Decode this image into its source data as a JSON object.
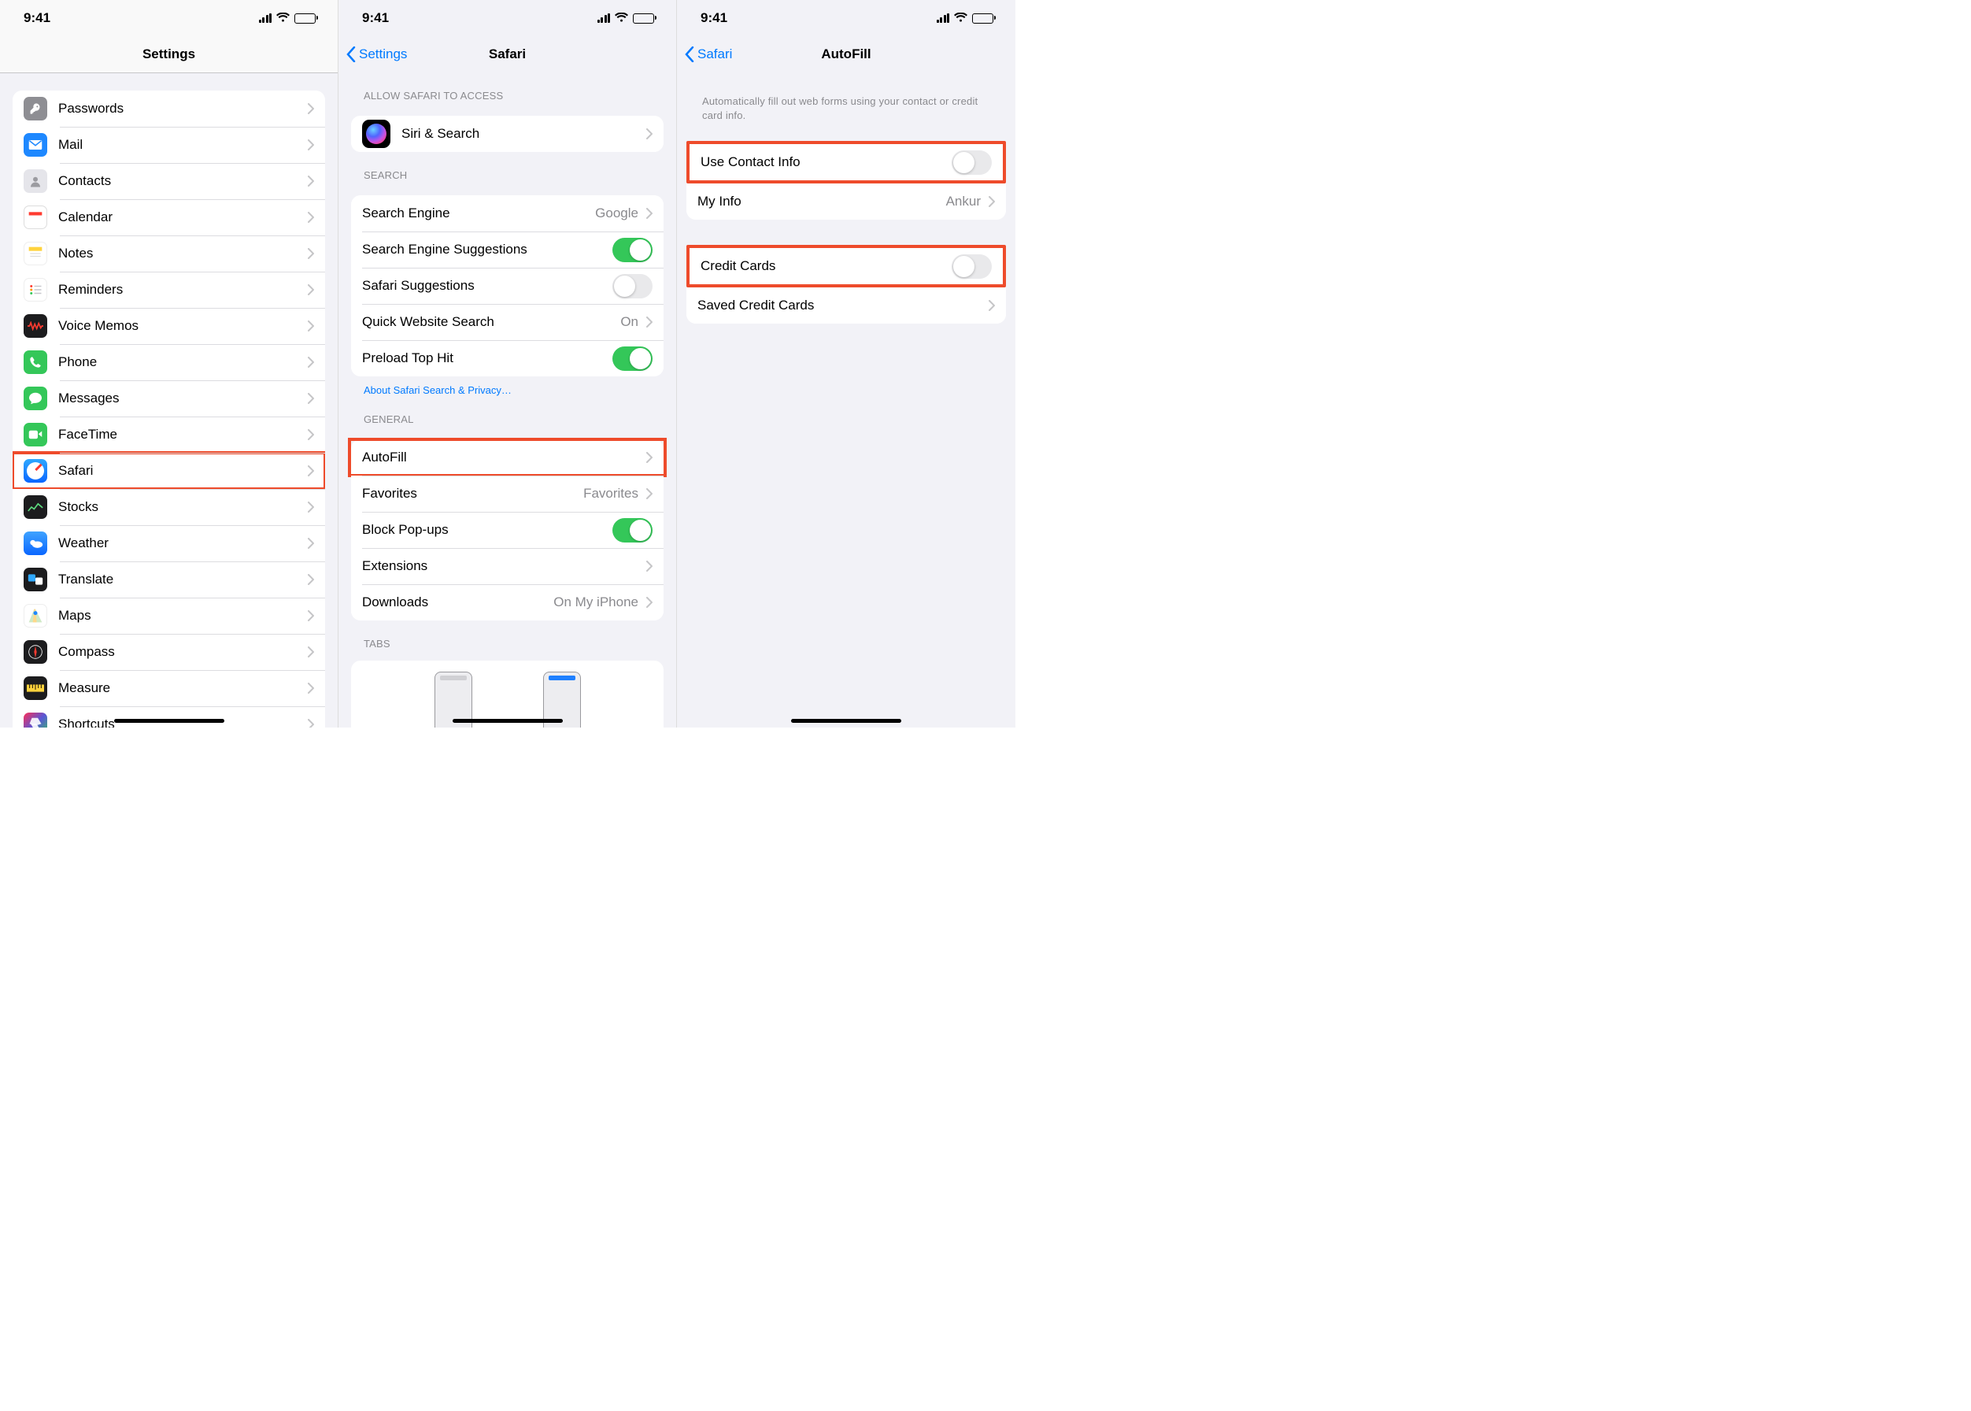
{
  "status": {
    "time": "9:41"
  },
  "p1": {
    "title": "Settings",
    "items": [
      {
        "label": "Passwords",
        "icon_name": "key-icon"
      },
      {
        "label": "Mail",
        "icon_name": "mail-icon"
      },
      {
        "label": "Contacts",
        "icon_name": "contacts-icon"
      },
      {
        "label": "Calendar",
        "icon_name": "calendar-icon"
      },
      {
        "label": "Notes",
        "icon_name": "notes-icon"
      },
      {
        "label": "Reminders",
        "icon_name": "reminders-icon"
      },
      {
        "label": "Voice Memos",
        "icon_name": "voice-memos-icon"
      },
      {
        "label": "Phone",
        "icon_name": "phone-icon"
      },
      {
        "label": "Messages",
        "icon_name": "messages-icon"
      },
      {
        "label": "FaceTime",
        "icon_name": "facetime-icon"
      },
      {
        "label": "Safari",
        "icon_name": "safari-icon",
        "highlighted": true
      },
      {
        "label": "Stocks",
        "icon_name": "stocks-icon"
      },
      {
        "label": "Weather",
        "icon_name": "weather-icon"
      },
      {
        "label": "Translate",
        "icon_name": "translate-icon"
      },
      {
        "label": "Maps",
        "icon_name": "maps-icon"
      },
      {
        "label": "Compass",
        "icon_name": "compass-icon"
      },
      {
        "label": "Measure",
        "icon_name": "measure-icon"
      },
      {
        "label": "Shortcuts",
        "icon_name": "shortcuts-icon"
      }
    ]
  },
  "p2": {
    "back": "Settings",
    "title": "Safari",
    "section_access": "ALLOW SAFARI TO ACCESS",
    "siri": "Siri & Search",
    "section_search": "SEARCH",
    "search_engine_label": "Search Engine",
    "search_engine_value": "Google",
    "suggestions_label": "Search Engine Suggestions",
    "suggestions_on": true,
    "safari_sugg_label": "Safari Suggestions",
    "safari_sugg_on": false,
    "quick_label": "Quick Website Search",
    "quick_value": "On",
    "preload_label": "Preload Top Hit",
    "preload_on": true,
    "about_link": "About Safari Search & Privacy…",
    "section_general": "GENERAL",
    "autofill_label": "AutoFill",
    "favorites_label": "Favorites",
    "favorites_value": "Favorites",
    "popups_label": "Block Pop-ups",
    "popups_on": true,
    "extensions_label": "Extensions",
    "downloads_label": "Downloads",
    "downloads_value": "On My iPhone",
    "section_tabs": "TABS"
  },
  "p3": {
    "back": "Safari",
    "title": "AutoFill",
    "intro": "Automatically fill out web forms using your contact or credit card info.",
    "use_contact_label": "Use Contact Info",
    "use_contact_on": false,
    "myinfo_label": "My Info",
    "myinfo_value": "Ankur",
    "cc_label": "Credit Cards",
    "cc_on": false,
    "saved_cc_label": "Saved Credit Cards"
  }
}
